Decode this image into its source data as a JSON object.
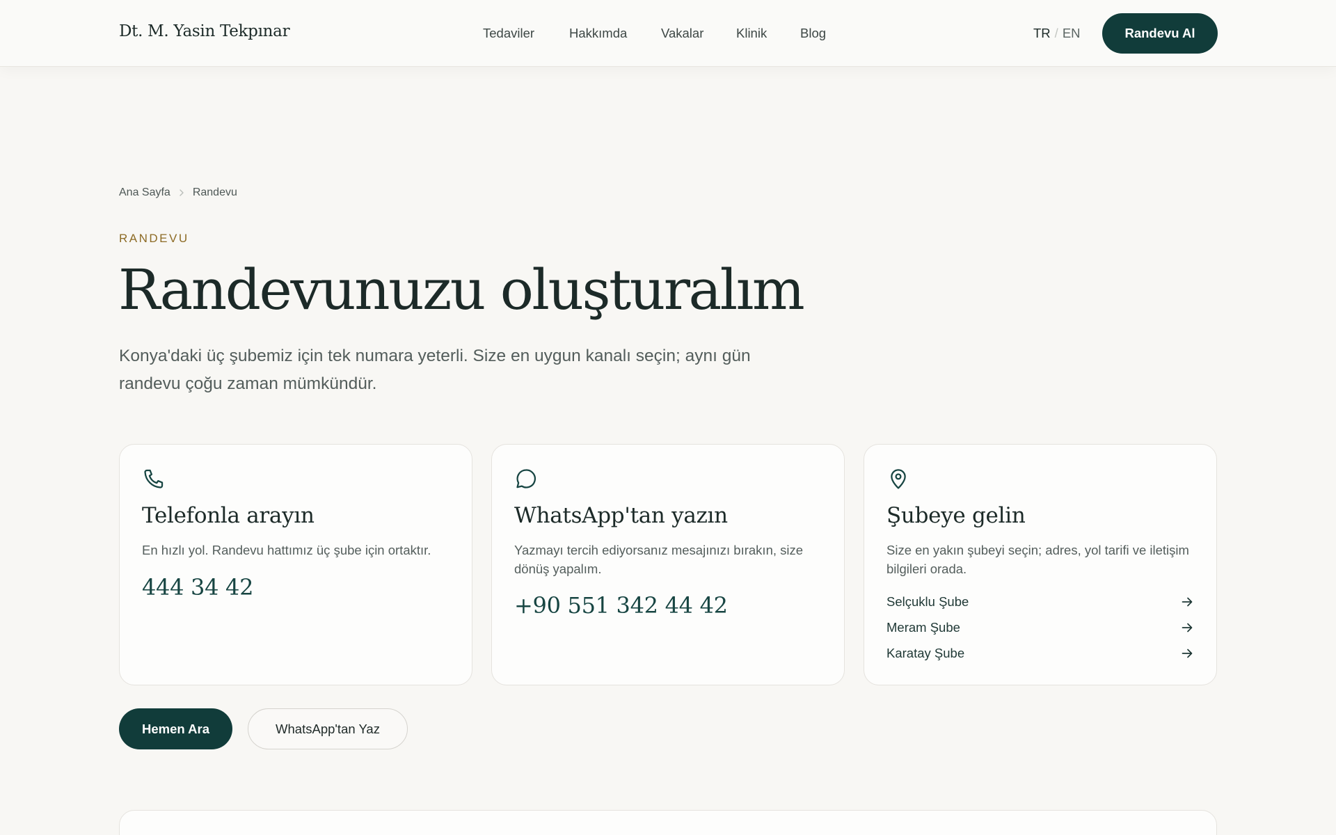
{
  "header": {
    "logo": "Dt. M. Yasin Tekpınar",
    "nav": [
      {
        "label": "Tedaviler"
      },
      {
        "label": "Hakkımda"
      },
      {
        "label": "Vakalar"
      },
      {
        "label": "Klinik"
      },
      {
        "label": "Blog"
      }
    ],
    "lang": {
      "active": "TR",
      "separator": "/",
      "inactive": "EN"
    },
    "cta_label": "Randevu Al"
  },
  "breadcrumb": {
    "home": "Ana Sayfa",
    "current": "Randevu"
  },
  "hero": {
    "eyebrow": "RANDEVU",
    "title": "Randevunuzu oluşturalım",
    "subtitle": "Konya'daki üç şubemiz için tek numara yeterli. Size en uygun kanalı seçin; aynı gün randevu çoğu zaman mümkündür."
  },
  "cards": {
    "phone": {
      "icon": "phone-icon",
      "title": "Telefonla arayın",
      "description": "En hızlı yol. Randevu hattımız üç şube için ortaktır.",
      "number": "444 34 42"
    },
    "whatsapp": {
      "icon": "message-bubble-icon",
      "title": "WhatsApp'tan yazın",
      "description": "Yazmayı tercih ediyorsanız mesajınızı bırakın, size dönüş yapalım.",
      "number": "+90 551 342 44 42"
    },
    "branch": {
      "icon": "map-pin-icon",
      "title": "Şubeye gelin",
      "description": "Size en yakın şubeyi seçin; adres, yol tarifi ve iletişim bilgileri orada.",
      "branches": [
        {
          "label": "Selçuklu Şube"
        },
        {
          "label": "Meram Şube"
        },
        {
          "label": "Karatay Şube"
        }
      ]
    }
  },
  "actions": {
    "call_label": "Hemen Ara",
    "whatsapp_label": "WhatsApp'tan Yaz"
  },
  "colors": {
    "accent": "#113c3a",
    "eyebrow": "#8d6b25",
    "background": "#f8f7f4"
  }
}
